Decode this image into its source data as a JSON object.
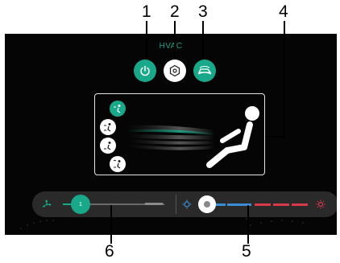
{
  "callouts": [
    "1",
    "2",
    "3",
    "4",
    "5",
    "6"
  ],
  "screen": {
    "title": "HVAC",
    "top_buttons": [
      {
        "icon": "power-icon",
        "state": "active"
      },
      {
        "icon": "recirculation-icon",
        "state": "inactive"
      },
      {
        "icon": "air-intake-icon",
        "state": "active"
      }
    ],
    "airflow_modes": [
      {
        "icon": "face-airflow-icon",
        "state": "active"
      },
      {
        "icon": "face-feet-airflow-icon",
        "state": "inactive"
      },
      {
        "icon": "feet-airflow-icon",
        "state": "inactive"
      },
      {
        "icon": "feet-defrost-airflow-icon",
        "state": "inactive"
      }
    ],
    "fan_speed": {
      "label": "1",
      "level_fraction": 0.0
    },
    "temperature": {
      "level_fraction": 0.05
    },
    "colors": {
      "accent": "#19a98a",
      "cold": "#3a8fd6",
      "hot": "#d83a4a",
      "background": "#050505"
    }
  }
}
